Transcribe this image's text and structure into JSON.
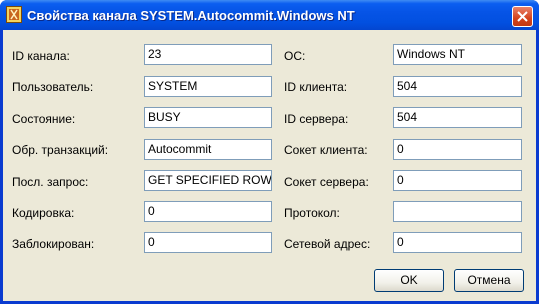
{
  "window": {
    "title": "Свойства канала SYSTEM.Autocommit.Windows NT"
  },
  "left_fields": [
    {
      "label": "ID канала:",
      "value": "23"
    },
    {
      "label": "Пользователь:",
      "value": "SYSTEM"
    },
    {
      "label": "Состояние:",
      "value": "BUSY"
    },
    {
      "label": "Обр. транзакций:",
      "value": "Autocommit"
    },
    {
      "label": "Посл. запрос:",
      "value": "GET SPECIFIED ROW"
    },
    {
      "label": "Кодировка:",
      "value": "0"
    },
    {
      "label": "Заблокирован:",
      "value": "0"
    }
  ],
  "right_fields": [
    {
      "label": "ОС:",
      "value": "Windows NT"
    },
    {
      "label": "ID клиента:",
      "value": "504"
    },
    {
      "label": "ID сервера:",
      "value": "504"
    },
    {
      "label": "Сокет клиента:",
      "value": "0"
    },
    {
      "label": "Сокет сервера:",
      "value": "0"
    },
    {
      "label": "Протокол:",
      "value": ""
    },
    {
      "label": "Сетевой адрес:",
      "value": "0"
    }
  ],
  "buttons": {
    "ok": "OK",
    "cancel": "Отмена"
  },
  "colors": {
    "titlebar": "#0654e6",
    "dialog_bg": "#ece9d8",
    "field_border": "#7f9db9",
    "close_button": "#d4431c"
  },
  "icons": {
    "app": "app-icon",
    "close": "close-icon"
  }
}
